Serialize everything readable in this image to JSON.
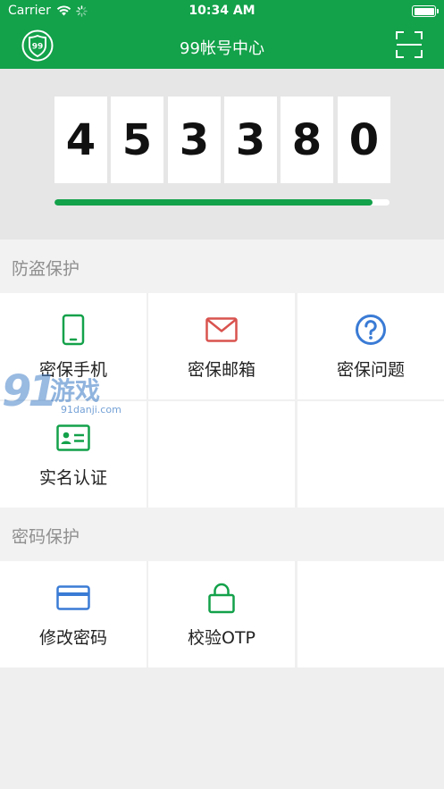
{
  "status": {
    "carrier": "Carrier",
    "time": "10:34 AM"
  },
  "nav": {
    "title": "99帐号中心",
    "logo_text": "99"
  },
  "otp": {
    "digits": [
      "4",
      "5",
      "3",
      "3",
      "8",
      "0"
    ],
    "progress_percent": 95
  },
  "sections": [
    {
      "title": "防盗保护",
      "items": [
        {
          "label": "密保手机",
          "icon": "phone-icon",
          "color": "#13a14a"
        },
        {
          "label": "密保邮箱",
          "icon": "mail-icon",
          "color": "#d9534f"
        },
        {
          "label": "密保问题",
          "icon": "question-icon",
          "color": "#3a7bd5"
        },
        {
          "label": "实名认证",
          "icon": "id-card-icon",
          "color": "#13a14a"
        }
      ]
    },
    {
      "title": "密码保护",
      "items": [
        {
          "label": "修改密码",
          "icon": "credit-card-icon",
          "color": "#3a7bd5"
        },
        {
          "label": "校验OTP",
          "icon": "lock-icon",
          "color": "#13a14a"
        }
      ]
    }
  ],
  "watermark": {
    "big": "91",
    "text": "游戏",
    "url": "91danji.com"
  },
  "colors": {
    "brand": "#13a14a",
    "otp_bg": "#e6e6e6",
    "section_text": "#8f8f8f"
  }
}
